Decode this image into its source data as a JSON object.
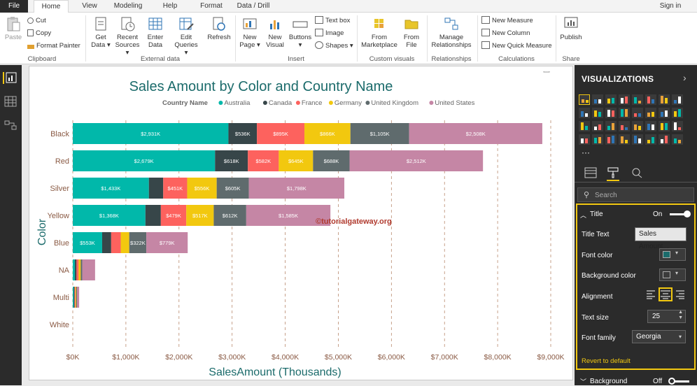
{
  "ribbon": {
    "tabs": [
      "File",
      "Home",
      "View",
      "Modeling",
      "Help",
      "Format",
      "Data / Drill"
    ],
    "sign_in": "Sign in",
    "clipboard": {
      "paste": "Paste",
      "cut": "Cut",
      "copy": "Copy",
      "format_painter": "Format Painter",
      "label": "Clipboard"
    },
    "external_data": {
      "get_data": "Get Data",
      "recent_sources": "Recent Sources",
      "enter_data": "Enter Data",
      "edit_queries": "Edit Queries",
      "refresh": "Refresh",
      "label": "External data"
    },
    "insert": {
      "new_page": "New Page",
      "new_visual": "New Visual",
      "buttons": "Buttons",
      "text_box": "Text box",
      "image": "Image",
      "shapes": "Shapes",
      "label": "Insert"
    },
    "custom_visuals": {
      "from_marketplace": "From Marketplace",
      "from_file": "From File",
      "label": "Custom visuals"
    },
    "relationships": {
      "manage": "Manage Relationships",
      "label": "Relationships"
    },
    "calculations": {
      "new_measure": "New Measure",
      "new_column": "New Column",
      "new_quick_measure": "New Quick Measure",
      "label": "Calculations"
    },
    "share": {
      "publish": "Publish",
      "label": "Share"
    }
  },
  "watermark": "©tutorialgateway.org",
  "chart_data": {
    "type": "bar",
    "orientation": "horizontal",
    "stacked": true,
    "title": "Sales Amount by Color and Country Name",
    "xlabel": "SalesAmount (Thousands)",
    "ylabel": "Color",
    "legend_title": "Country Name",
    "legend_position": "top",
    "xlim": [
      0,
      9000
    ],
    "x_ticks": [
      "$0K",
      "$1,000K",
      "$2,000K",
      "$3,000K",
      "$4,000K",
      "$5,000K",
      "$6,000K",
      "$7,000K",
      "$8,000K",
      "$9,000K"
    ],
    "x_tick_values": [
      0,
      1000,
      2000,
      3000,
      4000,
      5000,
      6000,
      7000,
      8000,
      9000
    ],
    "categories": [
      "Black",
      "Red",
      "Silver",
      "Yellow",
      "Blue",
      "NA",
      "Multi",
      "White"
    ],
    "series": [
      {
        "name": "Australia",
        "color": "#01b8aa",
        "values": [
          2931,
          2679,
          1433,
          1368,
          553,
          40,
          20,
          0
        ],
        "labels": [
          "$2,931K",
          "$2,679K",
          "$1,433K",
          "$1,368K",
          "$553K",
          "",
          "",
          ""
        ]
      },
      {
        "name": "Canada",
        "color": "#374649",
        "values": [
          536,
          618,
          270,
          290,
          170,
          30,
          15,
          0
        ],
        "labels": [
          "$536K",
          "$618K",
          "",
          "",
          "",
          "",
          "",
          ""
        ]
      },
      {
        "name": "France",
        "color": "#fd625e",
        "values": [
          895,
          582,
          451,
          479,
          180,
          40,
          15,
          0
        ],
        "labels": [
          "$895K",
          "$582K",
          "$451K",
          "$479K",
          "",
          "",
          "",
          ""
        ]
      },
      {
        "name": "Germany",
        "color": "#f2c80f",
        "values": [
          866,
          645,
          556,
          517,
          160,
          40,
          15,
          0
        ],
        "labels": [
          "$866K",
          "$645K",
          "$556K",
          "$517K",
          "",
          "",
          "",
          ""
        ]
      },
      {
        "name": "United Kingdom",
        "color": "#5f6b6d",
        "values": [
          1105,
          688,
          605,
          612,
          322,
          30,
          15,
          0
        ],
        "labels": [
          "$1,105K",
          "$688K",
          "$605K",
          "$612K",
          "$322K",
          "",
          "",
          ""
        ]
      },
      {
        "name": "United States",
        "color": "#c586a5",
        "values": [
          2508,
          2512,
          1798,
          1585,
          779,
          240,
          40,
          0
        ],
        "labels": [
          "$2,508K",
          "$2,512K",
          "$1,798K",
          "$1,585K",
          "$779K",
          "",
          "",
          ""
        ]
      }
    ]
  },
  "visualizations": {
    "header": "VISUALIZATIONS",
    "search_placeholder": "Search",
    "title_section": {
      "label": "Title",
      "state": "On"
    },
    "title_text": {
      "label": "Title Text",
      "value": "Sales Amount..."
    },
    "font_color": {
      "label": "Font color",
      "value": "#1b6b6b"
    },
    "background_color": {
      "label": "Background color"
    },
    "alignment": {
      "label": "Alignment",
      "selected": "center"
    },
    "text_size": {
      "label": "Text size",
      "value": "25"
    },
    "font_family": {
      "label": "Font family",
      "value": "Georgia"
    },
    "revert": "Revert to default",
    "background_section": {
      "label": "Background",
      "state": "Off"
    }
  }
}
